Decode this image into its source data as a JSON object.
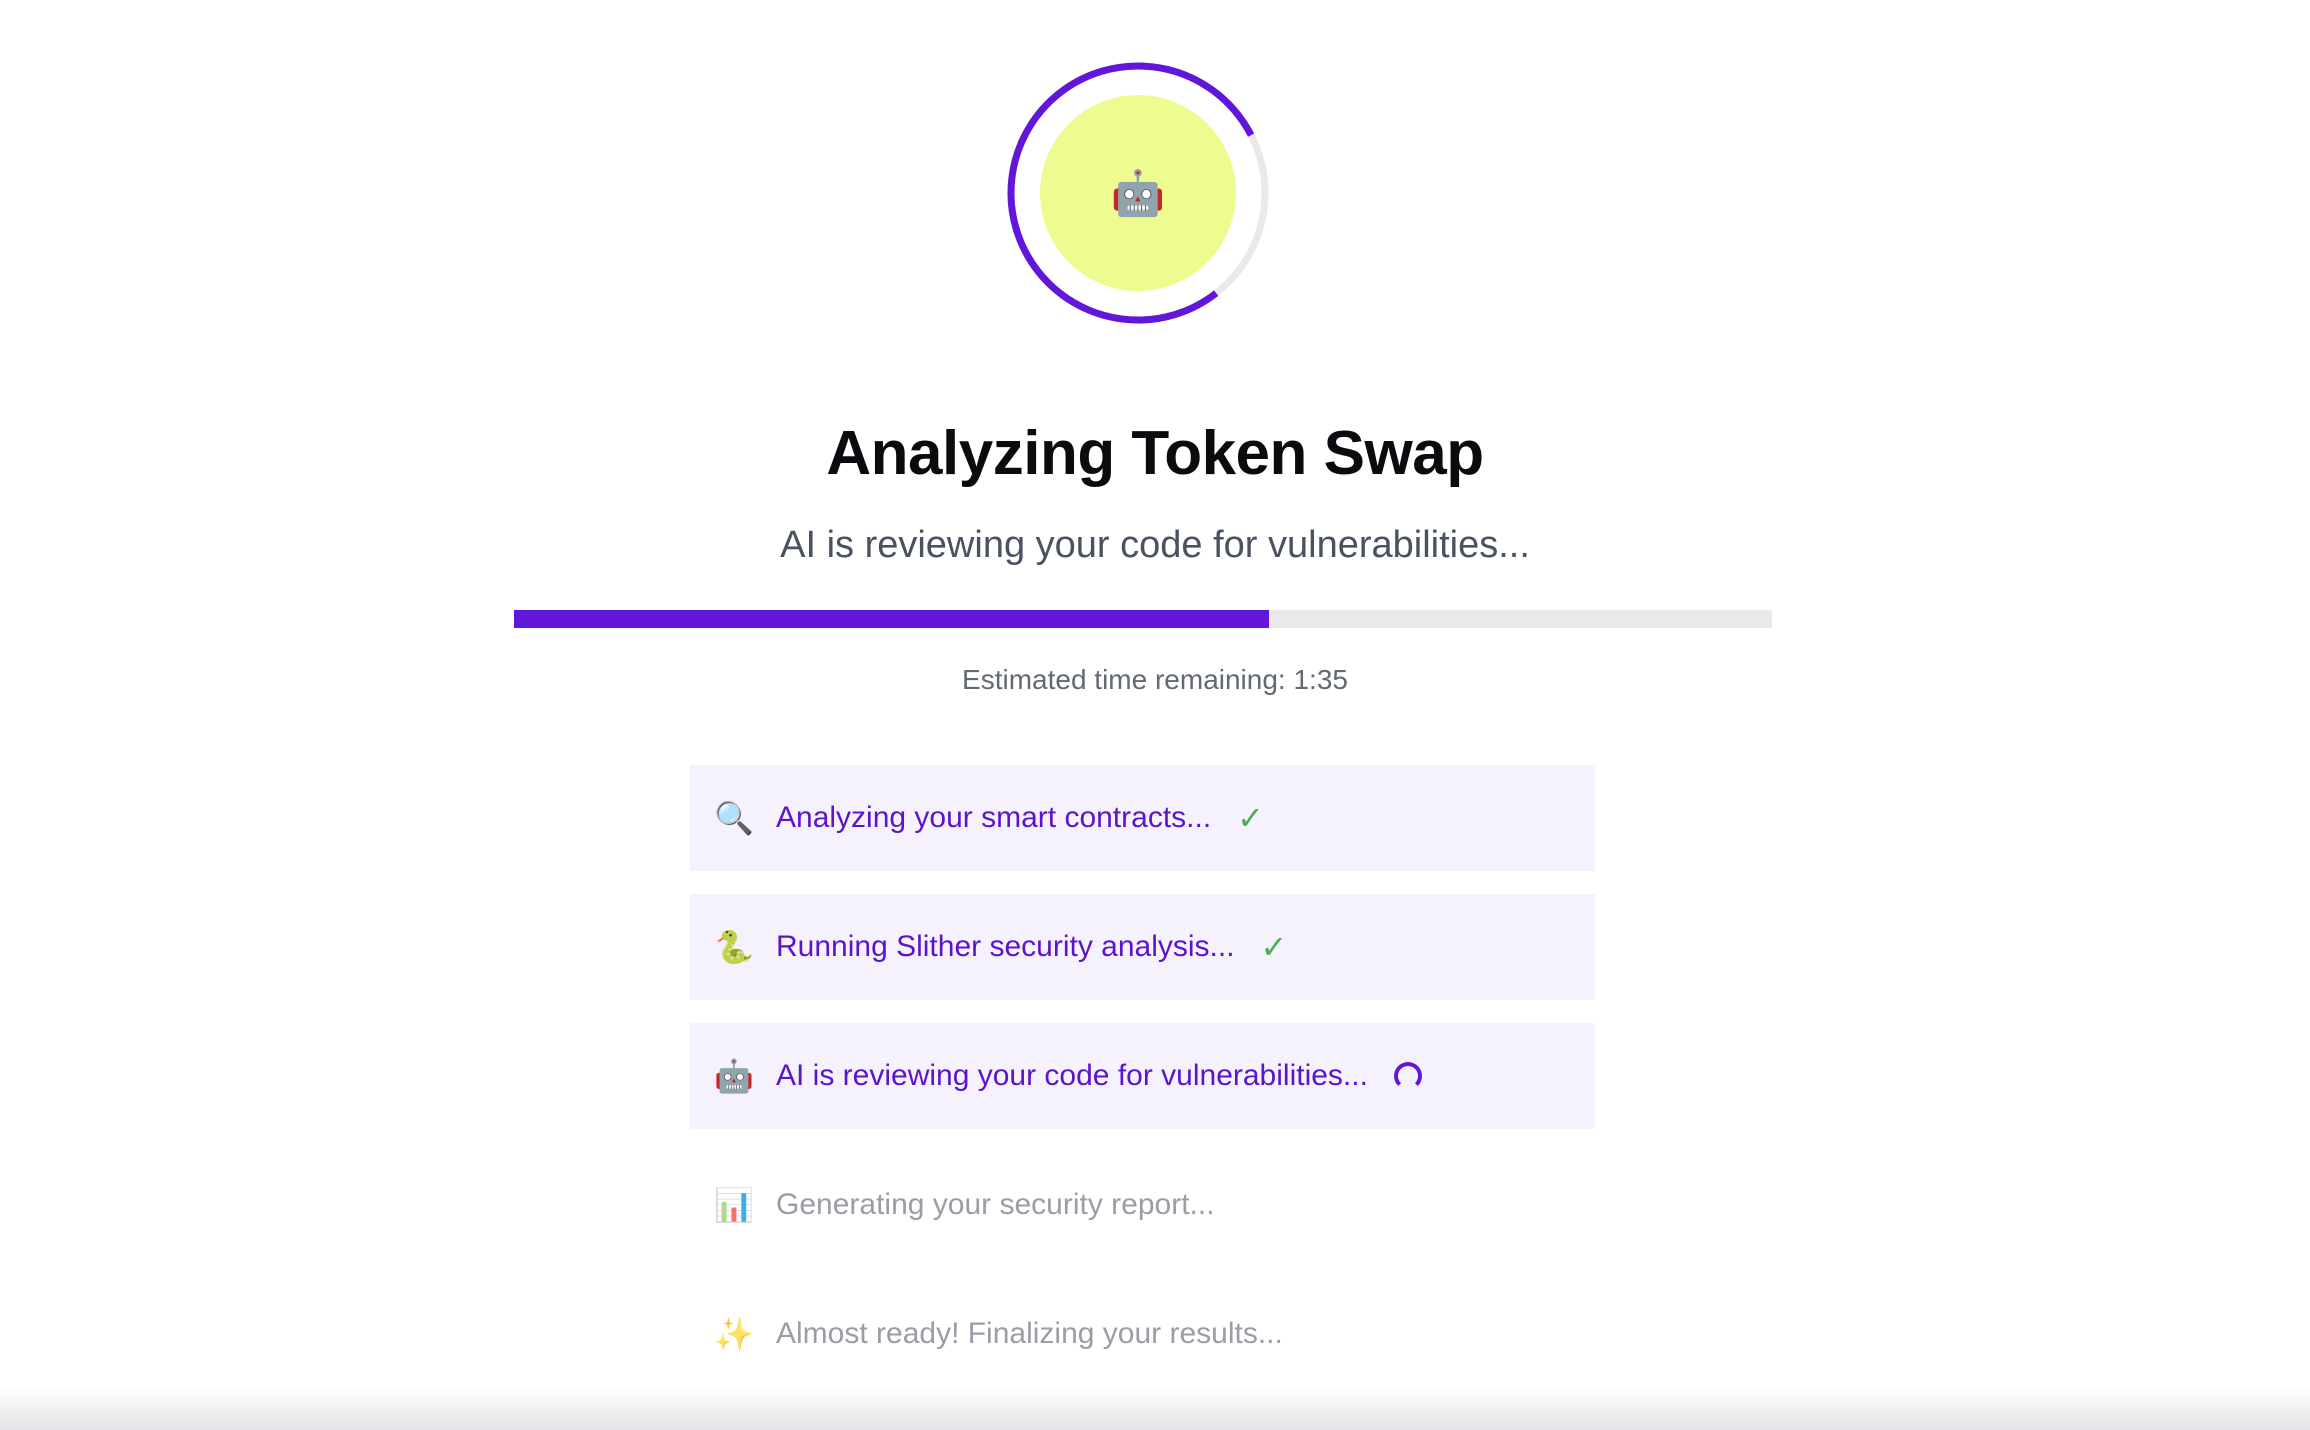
{
  "header": {
    "icon": "robot-icon",
    "icon_glyph": "🤖",
    "title": "Analyzing Token Swap",
    "subtitle": "AI is reviewing your code for vulnerabilities..."
  },
  "progress": {
    "fraction": 0.6,
    "ring_fraction": 0.78,
    "eta_text": "Estimated time remaining: 1:35"
  },
  "steps": [
    {
      "icon": "magnifying-glass-icon",
      "glyph": "🔍",
      "label": "Analyzing your smart contracts...",
      "status": "done"
    },
    {
      "icon": "snake-icon",
      "glyph": "🐍",
      "label": "Running Slither security analysis...",
      "status": "done"
    },
    {
      "icon": "robot-icon",
      "glyph": "🤖",
      "label": "AI is reviewing your code for vulnerabilities...",
      "status": "in-progress"
    },
    {
      "icon": "bar-chart-icon",
      "glyph": "📊",
      "label": "Generating your security report...",
      "status": "pending"
    },
    {
      "icon": "sparkles-icon",
      "glyph": "✨",
      "label": "Almost ready! Finalizing your results...",
      "status": "pending"
    }
  ],
  "colors": {
    "accent": "#6216d9",
    "ring_center": "#eefc8f",
    "track": "#e9e9ec",
    "step_active_bg": "#f6f2fd",
    "check": "#4caf50"
  }
}
